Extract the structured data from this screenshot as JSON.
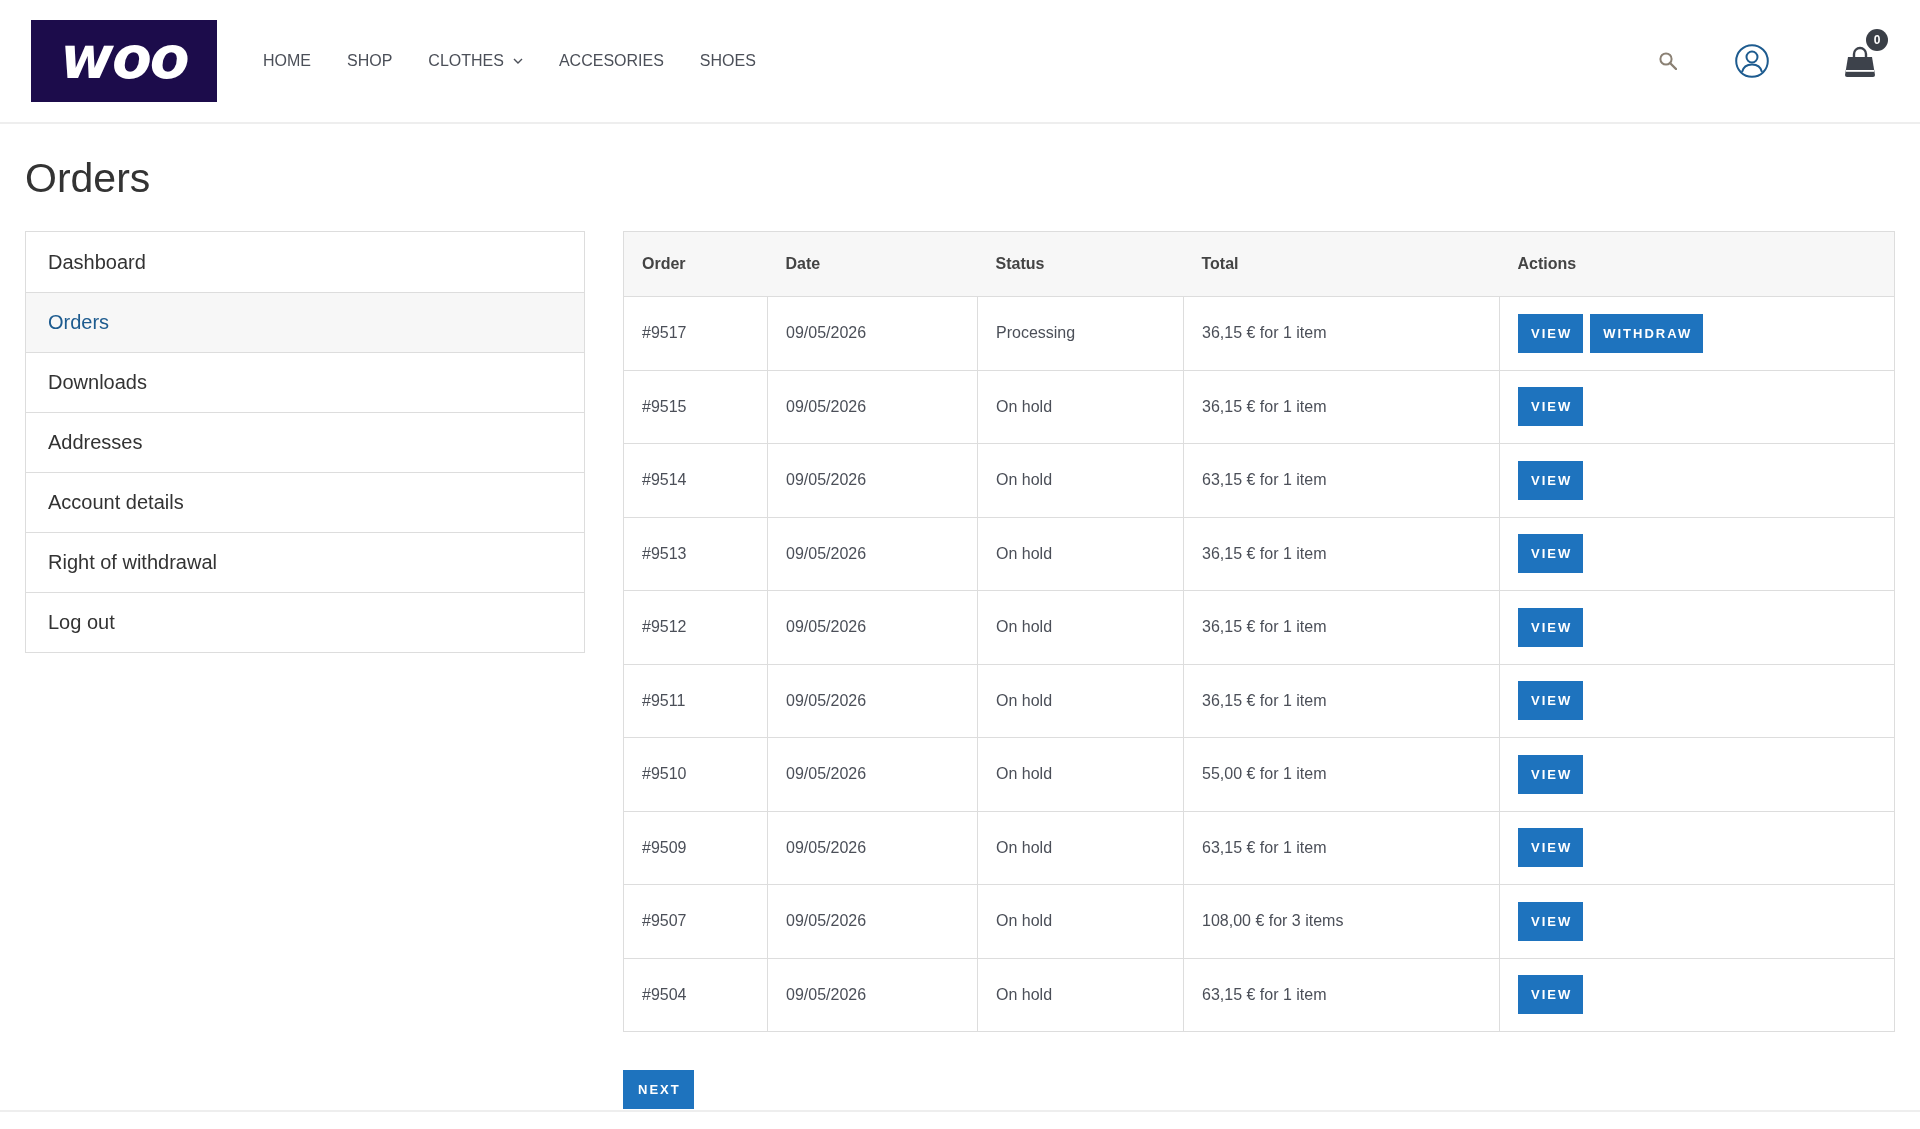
{
  "header": {
    "logo": "woo",
    "nav": [
      {
        "label": "HOME",
        "has_dropdown": false
      },
      {
        "label": "SHOP",
        "has_dropdown": false
      },
      {
        "label": "CLOTHES",
        "has_dropdown": true
      },
      {
        "label": "ACCESORIES",
        "has_dropdown": false
      },
      {
        "label": "SHOES",
        "has_dropdown": false
      }
    ],
    "cart_count": "0"
  },
  "page_title": "Orders",
  "account_menu": [
    {
      "label": "Dashboard",
      "selected": false
    },
    {
      "label": "Orders",
      "selected": true
    },
    {
      "label": "Downloads",
      "selected": false
    },
    {
      "label": "Addresses",
      "selected": false
    },
    {
      "label": "Account details",
      "selected": false
    },
    {
      "label": "Right of withdrawal",
      "selected": false
    },
    {
      "label": "Log out",
      "selected": false
    }
  ],
  "orders_table": {
    "columns": [
      "Order",
      "Date",
      "Status",
      "Total",
      "Actions"
    ],
    "rows": [
      {
        "order": "#9517",
        "date": "09/05/2026",
        "status": "Processing",
        "total": "36,15 € for 1 item",
        "actions": [
          "VIEW",
          "WITHDRAW"
        ]
      },
      {
        "order": "#9515",
        "date": "09/05/2026",
        "status": "On hold",
        "total": "36,15 € for 1 item",
        "actions": [
          "VIEW"
        ]
      },
      {
        "order": "#9514",
        "date": "09/05/2026",
        "status": "On hold",
        "total": "63,15 € for 1 item",
        "actions": [
          "VIEW"
        ]
      },
      {
        "order": "#9513",
        "date": "09/05/2026",
        "status": "On hold",
        "total": "36,15 € for 1 item",
        "actions": [
          "VIEW"
        ]
      },
      {
        "order": "#9512",
        "date": "09/05/2026",
        "status": "On hold",
        "total": "36,15 € for 1 item",
        "actions": [
          "VIEW"
        ]
      },
      {
        "order": "#9511",
        "date": "09/05/2026",
        "status": "On hold",
        "total": "36,15 € for 1 item",
        "actions": [
          "VIEW"
        ]
      },
      {
        "order": "#9510",
        "date": "09/05/2026",
        "status": "On hold",
        "total": "55,00 € for 1 item",
        "actions": [
          "VIEW"
        ]
      },
      {
        "order": "#9509",
        "date": "09/05/2026",
        "status": "On hold",
        "total": "63,15 € for 1 item",
        "actions": [
          "VIEW"
        ]
      },
      {
        "order": "#9507",
        "date": "09/05/2026",
        "status": "On hold",
        "total": "108,00 € for 3 items",
        "actions": [
          "VIEW"
        ]
      },
      {
        "order": "#9504",
        "date": "09/05/2026",
        "status": "On hold",
        "total": "63,15 € for 1 item",
        "actions": [
          "VIEW"
        ]
      }
    ]
  },
  "pagination": {
    "next": "NEXT"
  }
}
